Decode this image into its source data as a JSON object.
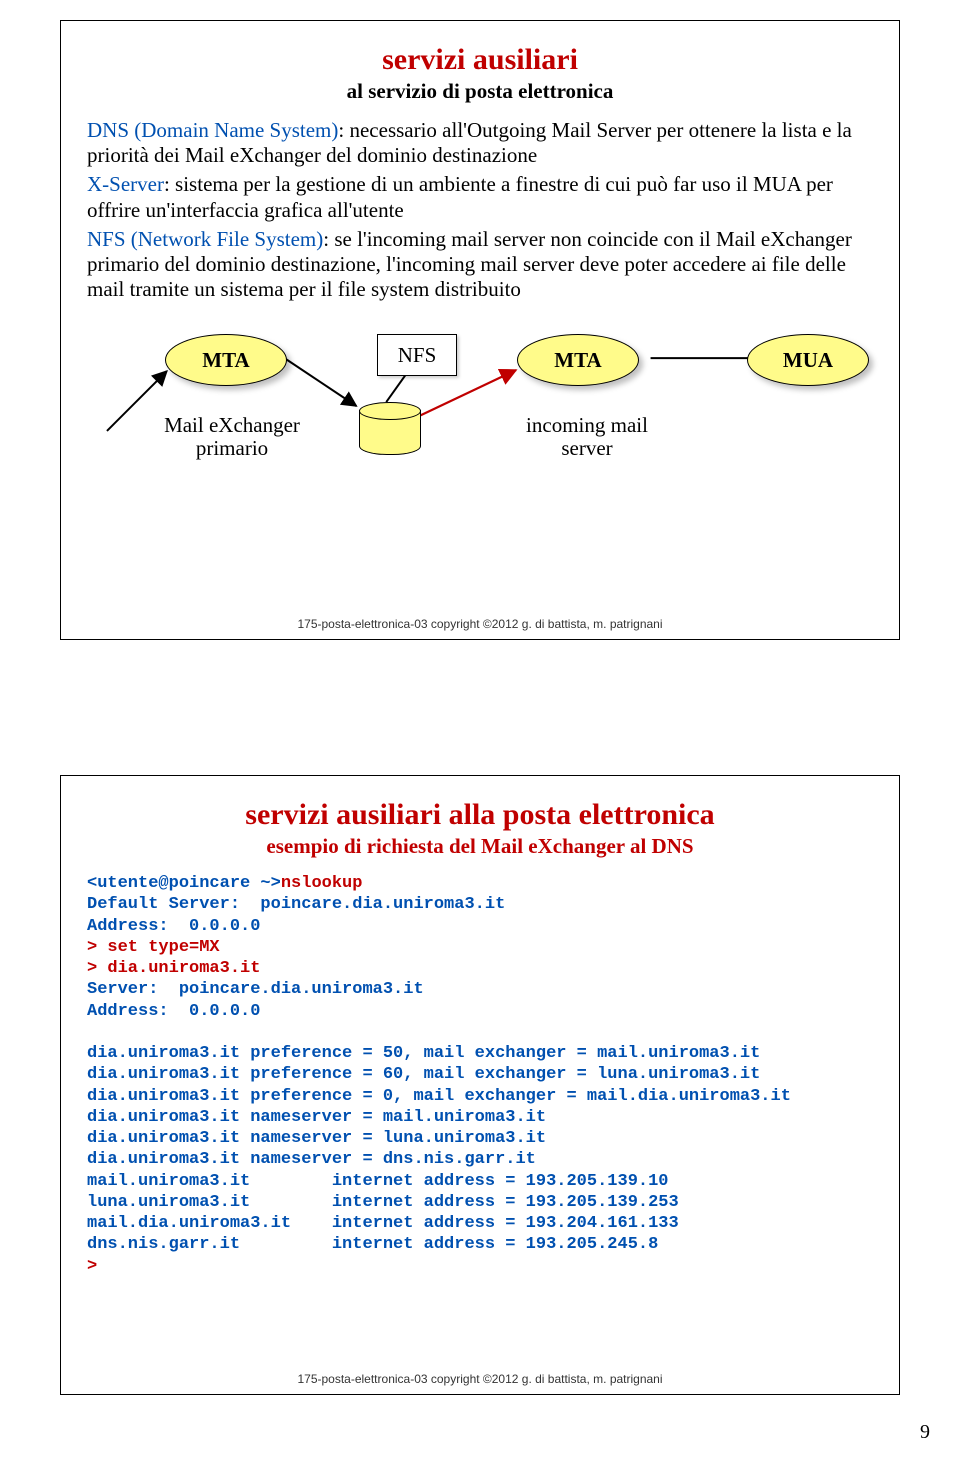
{
  "pageNumber": "9",
  "footer": "175-posta-elettronica-03      copyright ©2012 g. di battista, m. patrignani",
  "slide1": {
    "title": "servizi ausiliari",
    "subtitle": "al servizio di posta elettronica",
    "p1_kw": "DNS (Domain Name System)",
    "p1_rest": ": necessario all'Outgoing Mail Server per ottenere la lista e la priorità dei Mail eXchanger del dominio destinazione",
    "p2_kw": "X-Server",
    "p2_rest": ": sistema per la gestione di un ambiente a finestre di cui può far uso il  MUA per offrire un'interfaccia grafica all'utente",
    "p3_kw": "NFS (Network File System)",
    "p3_rest": ": se l'incoming mail server non coincide con il Mail eXchanger primario del dominio destinazione, l'incoming mail server deve poter accedere ai file delle mail tramite un sistema per il file system distribuito",
    "mta": "MTA",
    "nfs": "NFS",
    "mua": "MUA",
    "lbl1_a": "Mail eXchanger",
    "lbl1_b": "primario",
    "lbl2_a": "incoming mail",
    "lbl2_b": "server"
  },
  "slide2": {
    "title": "servizi ausiliari alla posta elettronica",
    "subtitle": "esempio di richiesta del Mail eXchanger al DNS",
    "terminal": [
      {
        "t": "blue",
        "txt": "<utente@poincare ~>"
      },
      {
        "t": "red",
        "txt": "nslookup"
      },
      {
        "t": "nl"
      },
      {
        "t": "blue",
        "txt": "Default Server:  poincare.dia.uniroma3.it"
      },
      {
        "t": "nl"
      },
      {
        "t": "blue",
        "txt": "Address:  0.0.0.0"
      },
      {
        "t": "nl"
      },
      {
        "t": "red",
        "txt": "> set type=MX"
      },
      {
        "t": "nl"
      },
      {
        "t": "red",
        "txt": "> dia.uniroma3.it"
      },
      {
        "t": "nl"
      },
      {
        "t": "blue",
        "txt": "Server:  poincare.dia.uniroma3.it"
      },
      {
        "t": "nl"
      },
      {
        "t": "blue",
        "txt": "Address:  0.0.0.0"
      },
      {
        "t": "nl"
      },
      {
        "t": "blank"
      },
      {
        "t": "blue",
        "txt": "dia.uniroma3.it preference = 50, mail exchanger = mail.uniroma3.it"
      },
      {
        "t": "nl"
      },
      {
        "t": "blue",
        "txt": "dia.uniroma3.it preference = 60, mail exchanger = luna.uniroma3.it"
      },
      {
        "t": "nl"
      },
      {
        "t": "blue",
        "txt": "dia.uniroma3.it preference = 0, mail exchanger = mail.dia.uniroma3.it"
      },
      {
        "t": "nl"
      },
      {
        "t": "blue",
        "txt": "dia.uniroma3.it nameserver = mail.uniroma3.it"
      },
      {
        "t": "nl"
      },
      {
        "t": "blue",
        "txt": "dia.uniroma3.it nameserver = luna.uniroma3.it"
      },
      {
        "t": "nl"
      },
      {
        "t": "blue",
        "txt": "dia.uniroma3.it nameserver = dns.nis.garr.it"
      },
      {
        "t": "nl"
      },
      {
        "t": "blue",
        "txt": "mail.uniroma3.it        internet address = 193.205.139.10"
      },
      {
        "t": "nl"
      },
      {
        "t": "blue",
        "txt": "luna.uniroma3.it        internet address = 193.205.139.253"
      },
      {
        "t": "nl"
      },
      {
        "t": "blue",
        "txt": "mail.dia.uniroma3.it    internet address = 193.204.161.133"
      },
      {
        "t": "nl"
      },
      {
        "t": "blue",
        "txt": "dns.nis.garr.it         internet address = 193.205.245.8"
      },
      {
        "t": "nl"
      },
      {
        "t": "red",
        "txt": ">"
      }
    ]
  }
}
